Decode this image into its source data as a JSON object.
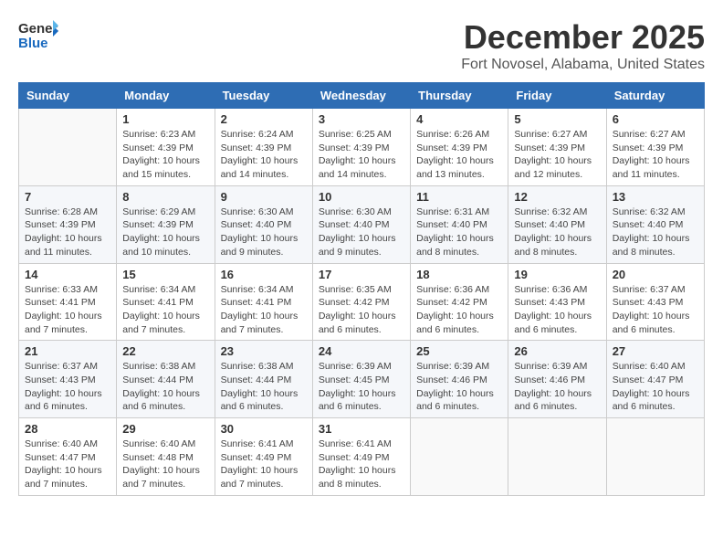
{
  "header": {
    "logo_general": "General",
    "logo_blue": "Blue",
    "month_title": "December 2025",
    "location": "Fort Novosel, Alabama, United States"
  },
  "days_of_week": [
    "Sunday",
    "Monday",
    "Tuesday",
    "Wednesday",
    "Thursday",
    "Friday",
    "Saturday"
  ],
  "weeks": [
    [
      {
        "day": "",
        "info": ""
      },
      {
        "day": "1",
        "info": "Sunrise: 6:23 AM\nSunset: 4:39 PM\nDaylight: 10 hours\nand 15 minutes."
      },
      {
        "day": "2",
        "info": "Sunrise: 6:24 AM\nSunset: 4:39 PM\nDaylight: 10 hours\nand 14 minutes."
      },
      {
        "day": "3",
        "info": "Sunrise: 6:25 AM\nSunset: 4:39 PM\nDaylight: 10 hours\nand 14 minutes."
      },
      {
        "day": "4",
        "info": "Sunrise: 6:26 AM\nSunset: 4:39 PM\nDaylight: 10 hours\nand 13 minutes."
      },
      {
        "day": "5",
        "info": "Sunrise: 6:27 AM\nSunset: 4:39 PM\nDaylight: 10 hours\nand 12 minutes."
      },
      {
        "day": "6",
        "info": "Sunrise: 6:27 AM\nSunset: 4:39 PM\nDaylight: 10 hours\nand 11 minutes."
      }
    ],
    [
      {
        "day": "7",
        "info": "Sunrise: 6:28 AM\nSunset: 4:39 PM\nDaylight: 10 hours\nand 11 minutes."
      },
      {
        "day": "8",
        "info": "Sunrise: 6:29 AM\nSunset: 4:39 PM\nDaylight: 10 hours\nand 10 minutes."
      },
      {
        "day": "9",
        "info": "Sunrise: 6:30 AM\nSunset: 4:40 PM\nDaylight: 10 hours\nand 9 minutes."
      },
      {
        "day": "10",
        "info": "Sunrise: 6:30 AM\nSunset: 4:40 PM\nDaylight: 10 hours\nand 9 minutes."
      },
      {
        "day": "11",
        "info": "Sunrise: 6:31 AM\nSunset: 4:40 PM\nDaylight: 10 hours\nand 8 minutes."
      },
      {
        "day": "12",
        "info": "Sunrise: 6:32 AM\nSunset: 4:40 PM\nDaylight: 10 hours\nand 8 minutes."
      },
      {
        "day": "13",
        "info": "Sunrise: 6:32 AM\nSunset: 4:40 PM\nDaylight: 10 hours\nand 8 minutes."
      }
    ],
    [
      {
        "day": "14",
        "info": "Sunrise: 6:33 AM\nSunset: 4:41 PM\nDaylight: 10 hours\nand 7 minutes."
      },
      {
        "day": "15",
        "info": "Sunrise: 6:34 AM\nSunset: 4:41 PM\nDaylight: 10 hours\nand 7 minutes."
      },
      {
        "day": "16",
        "info": "Sunrise: 6:34 AM\nSunset: 4:41 PM\nDaylight: 10 hours\nand 7 minutes."
      },
      {
        "day": "17",
        "info": "Sunrise: 6:35 AM\nSunset: 4:42 PM\nDaylight: 10 hours\nand 6 minutes."
      },
      {
        "day": "18",
        "info": "Sunrise: 6:36 AM\nSunset: 4:42 PM\nDaylight: 10 hours\nand 6 minutes."
      },
      {
        "day": "19",
        "info": "Sunrise: 6:36 AM\nSunset: 4:43 PM\nDaylight: 10 hours\nand 6 minutes."
      },
      {
        "day": "20",
        "info": "Sunrise: 6:37 AM\nSunset: 4:43 PM\nDaylight: 10 hours\nand 6 minutes."
      }
    ],
    [
      {
        "day": "21",
        "info": "Sunrise: 6:37 AM\nSunset: 4:43 PM\nDaylight: 10 hours\nand 6 minutes."
      },
      {
        "day": "22",
        "info": "Sunrise: 6:38 AM\nSunset: 4:44 PM\nDaylight: 10 hours\nand 6 minutes."
      },
      {
        "day": "23",
        "info": "Sunrise: 6:38 AM\nSunset: 4:44 PM\nDaylight: 10 hours\nand 6 minutes."
      },
      {
        "day": "24",
        "info": "Sunrise: 6:39 AM\nSunset: 4:45 PM\nDaylight: 10 hours\nand 6 minutes."
      },
      {
        "day": "25",
        "info": "Sunrise: 6:39 AM\nSunset: 4:46 PM\nDaylight: 10 hours\nand 6 minutes."
      },
      {
        "day": "26",
        "info": "Sunrise: 6:39 AM\nSunset: 4:46 PM\nDaylight: 10 hours\nand 6 minutes."
      },
      {
        "day": "27",
        "info": "Sunrise: 6:40 AM\nSunset: 4:47 PM\nDaylight: 10 hours\nand 6 minutes."
      }
    ],
    [
      {
        "day": "28",
        "info": "Sunrise: 6:40 AM\nSunset: 4:47 PM\nDaylight: 10 hours\nand 7 minutes."
      },
      {
        "day": "29",
        "info": "Sunrise: 6:40 AM\nSunset: 4:48 PM\nDaylight: 10 hours\nand 7 minutes."
      },
      {
        "day": "30",
        "info": "Sunrise: 6:41 AM\nSunset: 4:49 PM\nDaylight: 10 hours\nand 7 minutes."
      },
      {
        "day": "31",
        "info": "Sunrise: 6:41 AM\nSunset: 4:49 PM\nDaylight: 10 hours\nand 8 minutes."
      },
      {
        "day": "",
        "info": ""
      },
      {
        "day": "",
        "info": ""
      },
      {
        "day": "",
        "info": ""
      }
    ]
  ]
}
